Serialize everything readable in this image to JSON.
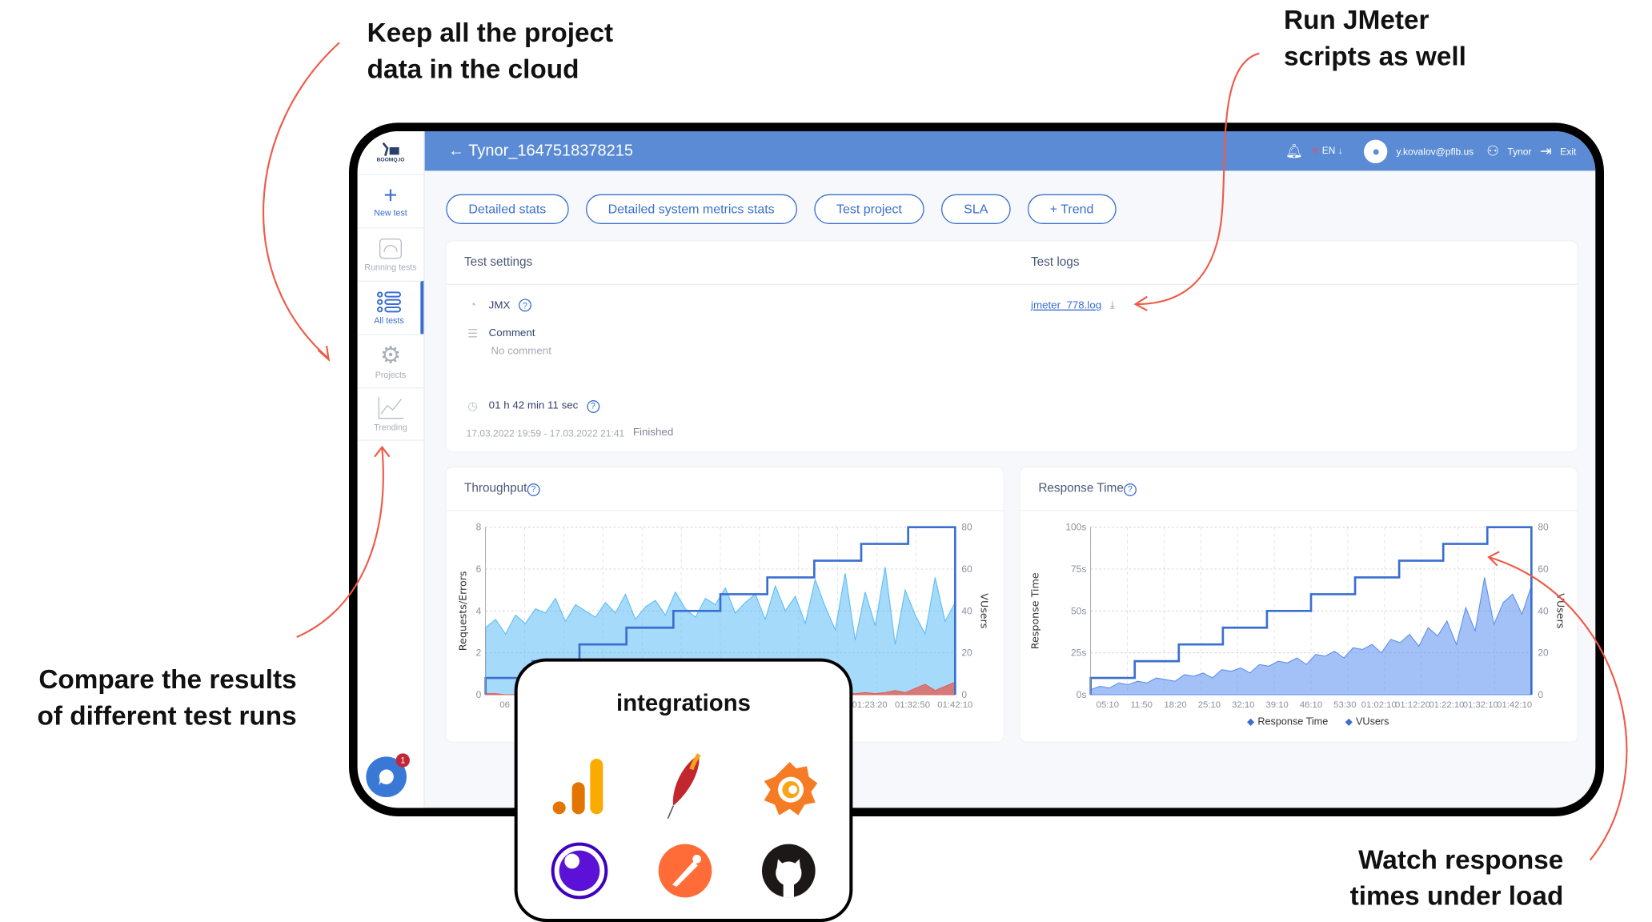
{
  "annotations": {
    "cloud": "Keep all the project\ndata in the cloud",
    "jmeter": "Run JMeter\nscripts as well",
    "compare": "Compare the results\nof different test runs",
    "watch": "Watch response\ntimes under load"
  },
  "sidebar": {
    "logo": "BOOMQ.IO",
    "items": [
      {
        "label": "New test",
        "icon": "plus-icon"
      },
      {
        "label": "Running tests",
        "icon": "speedometer-icon"
      },
      {
        "label": "All tests",
        "icon": "list-icon",
        "active": true
      },
      {
        "label": "Projects",
        "icon": "gear-icon"
      },
      {
        "label": "Trending",
        "icon": "trend-chart-icon"
      }
    ],
    "chat_badge": "1"
  },
  "header": {
    "title": "Tynor_1647518378215",
    "language": "EN",
    "email": "y.kovalov@pflb.us",
    "team": "Tynor",
    "exit": "Exit",
    "color": "#5b8bd4"
  },
  "tabs": [
    "Detailed stats",
    "Detailed system metrics stats",
    "Test project",
    "SLA",
    "+ Trend"
  ],
  "settings": {
    "title": "Test settings",
    "type": "JMX",
    "comment_label": "Comment",
    "comment": "No comment",
    "duration": "01 h 42 min 11 sec",
    "period": "17.03.2022 19:59 - 17.03.2022 21:41",
    "status": "Finished"
  },
  "logs": {
    "title": "Test logs",
    "file": "jmeter_778.log"
  },
  "chart_data": [
    {
      "type": "area",
      "title": "Throughput",
      "ylabel": "Requests/Errors",
      "y2label": "VUsers",
      "ylim": [
        0,
        8
      ],
      "y2lim": [
        0,
        80
      ],
      "yticks": [
        "0",
        "2",
        "4",
        "6",
        "8"
      ],
      "y2ticks": [
        "0",
        "20",
        "40",
        "60",
        "80"
      ],
      "xticks_visible": [
        "06",
        "01:23:20",
        "01:32:50",
        "01:42:10"
      ],
      "grid": true,
      "series": [
        {
          "name": "Requests",
          "color": "#5bbcf5",
          "values": [
            3.2,
            3.6,
            2.9,
            3.8,
            3.4,
            4.1,
            3.9,
            4.6,
            3.5,
            4.3,
            4.0,
            3.7,
            4.4,
            3.9,
            4.8,
            3.6,
            4.2,
            4.5,
            3.8,
            4.9,
            4.1,
            3.7,
            4.6,
            4.3,
            5.1,
            3.9,
            4.4,
            4.8,
            3.6,
            5.2,
            4.0,
            4.7,
            3.4,
            5.5,
            4.2,
            3.1,
            5.8,
            2.6,
            4.9,
            3.3,
            6.1,
            2.4,
            5.0,
            3.8,
            2.9,
            5.6,
            3.5,
            4.4
          ]
        },
        {
          "name": "Errors",
          "color": "#e0625a",
          "values": [
            0.05,
            0.05,
            0,
            0,
            0,
            0,
            0,
            0,
            0,
            0,
            0,
            0,
            0,
            0,
            0,
            0,
            0,
            0,
            0,
            0,
            0,
            0,
            0,
            0,
            0,
            0,
            0,
            0,
            0,
            0,
            0,
            0,
            0,
            0,
            0,
            0,
            0.05,
            0.05,
            0.1,
            0.05,
            0.1,
            0.2,
            0.1,
            0.3,
            0.5,
            0.2,
            0.4,
            0.6
          ]
        },
        {
          "name": "VUsers",
          "color": "#3a6fd0",
          "steps": [
            8,
            16,
            24,
            32,
            40,
            48,
            56,
            64,
            72,
            80
          ]
        }
      ]
    },
    {
      "type": "area",
      "title": "Response Time",
      "ylabel": "Response Time",
      "y2label": "VUsers",
      "ylim": [
        0,
        100
      ],
      "y2lim": [
        0,
        80
      ],
      "yticks": [
        "0s",
        "25s",
        "50s",
        "75s",
        "100s"
      ],
      "y2ticks": [
        "0",
        "20",
        "40",
        "60",
        "80"
      ],
      "xticks": [
        "05:10",
        "11:50",
        "18:20",
        "25:10",
        "32:10",
        "39:10",
        "46:10",
        "53:30",
        "01:02:10",
        "01:12:20",
        "01:22:10",
        "01:32:10",
        "01:42:10"
      ],
      "legend": [
        "Response Time",
        "VUsers"
      ],
      "legend_position": "bottom",
      "grid": true,
      "series": [
        {
          "name": "Response Time",
          "color": "#5a8ef0",
          "values": [
            3,
            5,
            4,
            7,
            6,
            8,
            7,
            10,
            9,
            8,
            12,
            11,
            13,
            10,
            15,
            14,
            16,
            13,
            18,
            17,
            20,
            19,
            22,
            18,
            24,
            23,
            26,
            22,
            28,
            27,
            30,
            25,
            33,
            31,
            36,
            29,
            40,
            35,
            44,
            30,
            52,
            38,
            70,
            42,
            55,
            60,
            48,
            65
          ]
        },
        {
          "name": "VUsers",
          "color": "#3a6fd0",
          "steps": [
            8,
            16,
            24,
            32,
            40,
            48,
            56,
            64,
            72,
            80
          ]
        }
      ]
    }
  ],
  "integrations": {
    "title": "integrations",
    "items": [
      "google-analytics-icon",
      "apache-feather-icon",
      "grafana-icon",
      "insomnia-icon",
      "postman-icon",
      "github-icon"
    ]
  }
}
